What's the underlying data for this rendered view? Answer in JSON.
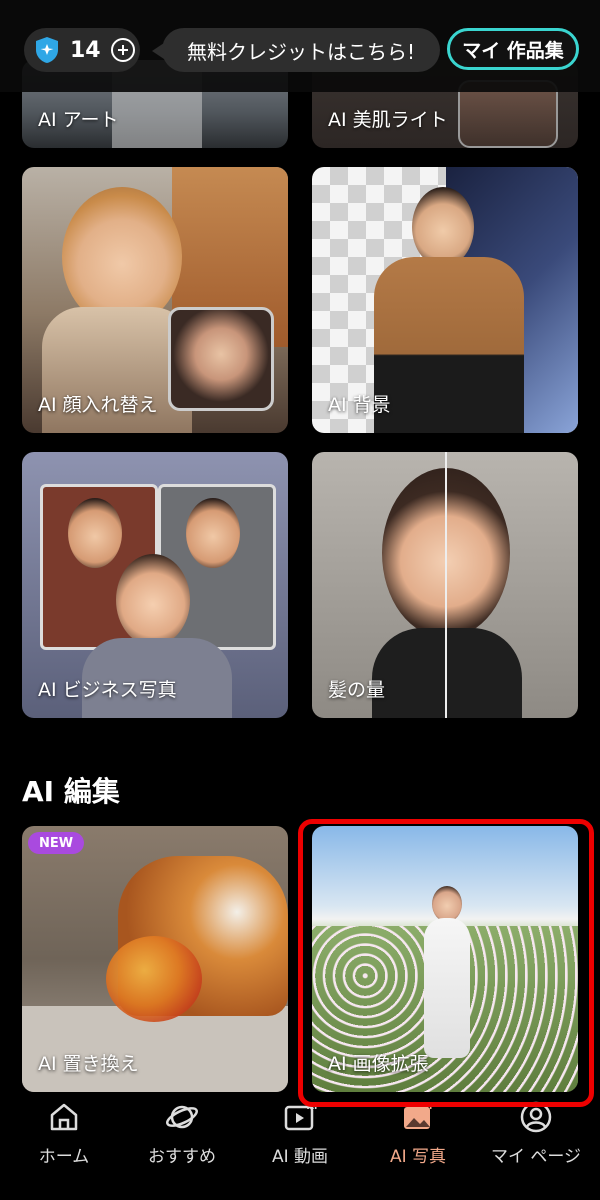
{
  "header": {
    "credits": "14",
    "tooltip": "無料クレジットはこちら!",
    "my_works": "マイ 作品集"
  },
  "cards": {
    "ai_art": "AI アート",
    "ai_skin": "AI 美肌ライト",
    "face_swap": "AI 顔入れ替え",
    "background": "AI 背景",
    "business_photo": "AI ビジネス写真",
    "hair_volume": "髪の量",
    "replace": "AI 置き換え",
    "expand": "AI 画像拡張",
    "new_badge": "NEW"
  },
  "section": {
    "ai_edit": "AI 編集"
  },
  "nav": {
    "items": [
      {
        "label": "ホーム",
        "icon": "home-icon"
      },
      {
        "label": "おすすめ",
        "icon": "planet-icon"
      },
      {
        "label": "AI 動画",
        "icon": "video-ai-icon"
      },
      {
        "label": "AI 写真",
        "icon": "photo-ai-icon"
      },
      {
        "label": "マイ ページ",
        "icon": "profile-icon"
      }
    ],
    "active_index": 3
  },
  "colors": {
    "accent_teal": "#3ad5d0",
    "new_badge": "#a94adf",
    "active_nav": "#f2a98a",
    "highlight": "#ee0000"
  }
}
